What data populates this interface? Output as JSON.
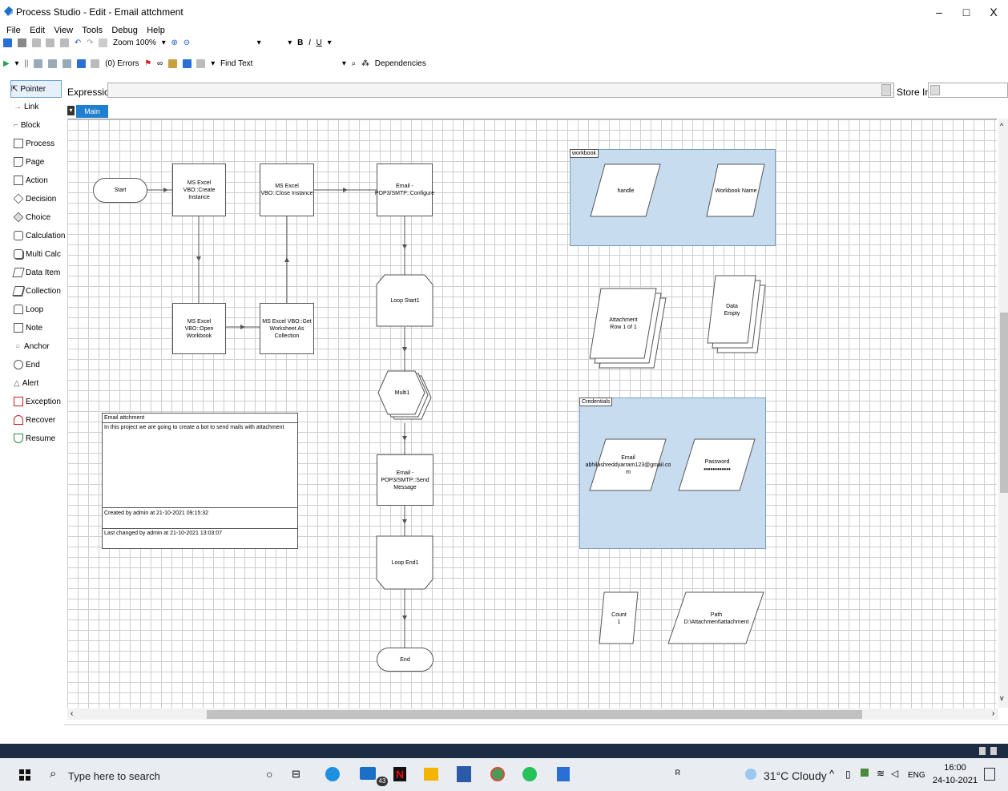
{
  "window": {
    "title": "Process Studio  - Edit - Email attchment",
    "controls": [
      "–",
      "□",
      "X"
    ]
  },
  "menu": [
    "File",
    "Edit",
    "View",
    "Tools",
    "Debug",
    "Help"
  ],
  "toolbar1": {
    "zoom": "Zoom 100%",
    "bold": "B",
    "italic": "I",
    "underline": "U"
  },
  "toolbar2": {
    "errors": "(0) Errors",
    "find_text": "Find Text",
    "dependencies": "Dependencies"
  },
  "palette": [
    "Pointer",
    "Link",
    "Block",
    "Process",
    "Page",
    "Action",
    "Decision",
    "Choice",
    "Calculation",
    "Multi Calc",
    "Data Item",
    "Collection",
    "Loop",
    "Note",
    "Anchor",
    "End",
    "Alert",
    "Exception",
    "Recover",
    "Resume"
  ],
  "expression": {
    "label": "Expression:",
    "value": "",
    "store_label": "Store In:"
  },
  "tab": {
    "label": "Main Page"
  },
  "flow": {
    "start": "Start",
    "create": "MS Excel VBO::Create Instance",
    "open": "MS Excel VBO::Open Workbook",
    "getws": "MS Excel VBO::Get Worksheet As Collection",
    "close": "MS Excel VBO::Close Instance",
    "configure": "Email - POP3/SMTP::Configure",
    "loopstart": "Loop Start1",
    "multi": "Multi1",
    "send": "Email - POP3/SMTP::Send Message",
    "loopend": "Loop End1",
    "end": "End"
  },
  "blocks": {
    "workbook": {
      "title": "workbook",
      "item1": "handle",
      "item2": "Workbook Name"
    },
    "credentials": {
      "title": "Credentials",
      "email_label": "Email",
      "email_value": "abhilashreddyarram123@gmail.com",
      "password_label": "Password",
      "password_value": "••••••••••••"
    }
  },
  "collections": {
    "attachment": {
      "label": "Attachment",
      "value": "Row 1 of 1"
    },
    "data": {
      "label": "Data",
      "value": "Empty"
    }
  },
  "items": {
    "count": {
      "label": "Count",
      "value": "1"
    },
    "path": {
      "label": "Path",
      "value": "D:\\Attachment\\attachment"
    }
  },
  "note": {
    "title": "Email attchment",
    "body": "In this project we are going to create a bot to send mails with attachment",
    "created": "Created by admin at 21-10-2021 09:15:32",
    "changed": "Last changed by admin at 21-10-2021 13:03:07"
  },
  "taskbar": {
    "search_placeholder": "Type here to search",
    "weather": "31°C  Cloudy",
    "lang": "ENG",
    "time": "16:00",
    "date": "24-10-2021",
    "mail_badge": "43"
  },
  "colors": {
    "block_fill": "#c8dcf0",
    "tab_blue": "#1f7fd0",
    "taskbar_dark": "#1c2c44"
  }
}
